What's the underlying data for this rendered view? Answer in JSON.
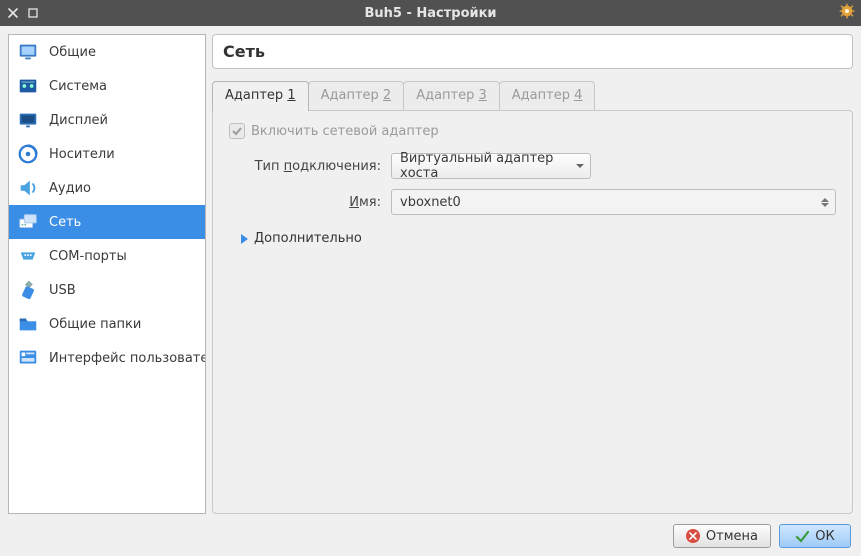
{
  "window": {
    "title": "Buh5 - Настройки"
  },
  "sidebar": {
    "items": [
      {
        "label": "Общие",
        "selected": false,
        "icon": "general"
      },
      {
        "label": "Система",
        "selected": false,
        "icon": "system"
      },
      {
        "label": "Дисплей",
        "selected": false,
        "icon": "display"
      },
      {
        "label": "Носители",
        "selected": false,
        "icon": "storage"
      },
      {
        "label": "Аудио",
        "selected": false,
        "icon": "audio"
      },
      {
        "label": "Сеть",
        "selected": true,
        "icon": "network"
      },
      {
        "label": "COM-порты",
        "selected": false,
        "icon": "serial"
      },
      {
        "label": "USB",
        "selected": false,
        "icon": "usb"
      },
      {
        "label": "Общие папки",
        "selected": false,
        "icon": "folder"
      },
      {
        "label": "Интерфейс пользователя",
        "selected": false,
        "icon": "ui"
      }
    ]
  },
  "main": {
    "heading": "Сеть",
    "tabs": [
      {
        "prefix": "Адаптер ",
        "accel": "1",
        "active": true
      },
      {
        "prefix": "Адаптер ",
        "accel": "2",
        "active": false
      },
      {
        "prefix": "Адаптер ",
        "accel": "3",
        "active": false
      },
      {
        "prefix": "Адаптер ",
        "accel": "4",
        "active": false
      }
    ],
    "enable_adapter": {
      "label": "Включить сетевой адаптер",
      "checked": true,
      "disabled": true
    },
    "attached": {
      "label_prefix": "Тип ",
      "label_accel": "п",
      "label_suffix": "одключения:",
      "value": "Виртуальный адаптер хоста"
    },
    "name": {
      "label_accel": "И",
      "label_suffix": "мя:",
      "value": "vboxnet0"
    },
    "advanced": {
      "label_accel": "Д",
      "label_suffix": "ополнительно",
      "expanded": false
    }
  },
  "footer": {
    "cancel": "Отмена",
    "ok": "ОК",
    "ok_accel": "О",
    "ok_suffix": "К"
  }
}
